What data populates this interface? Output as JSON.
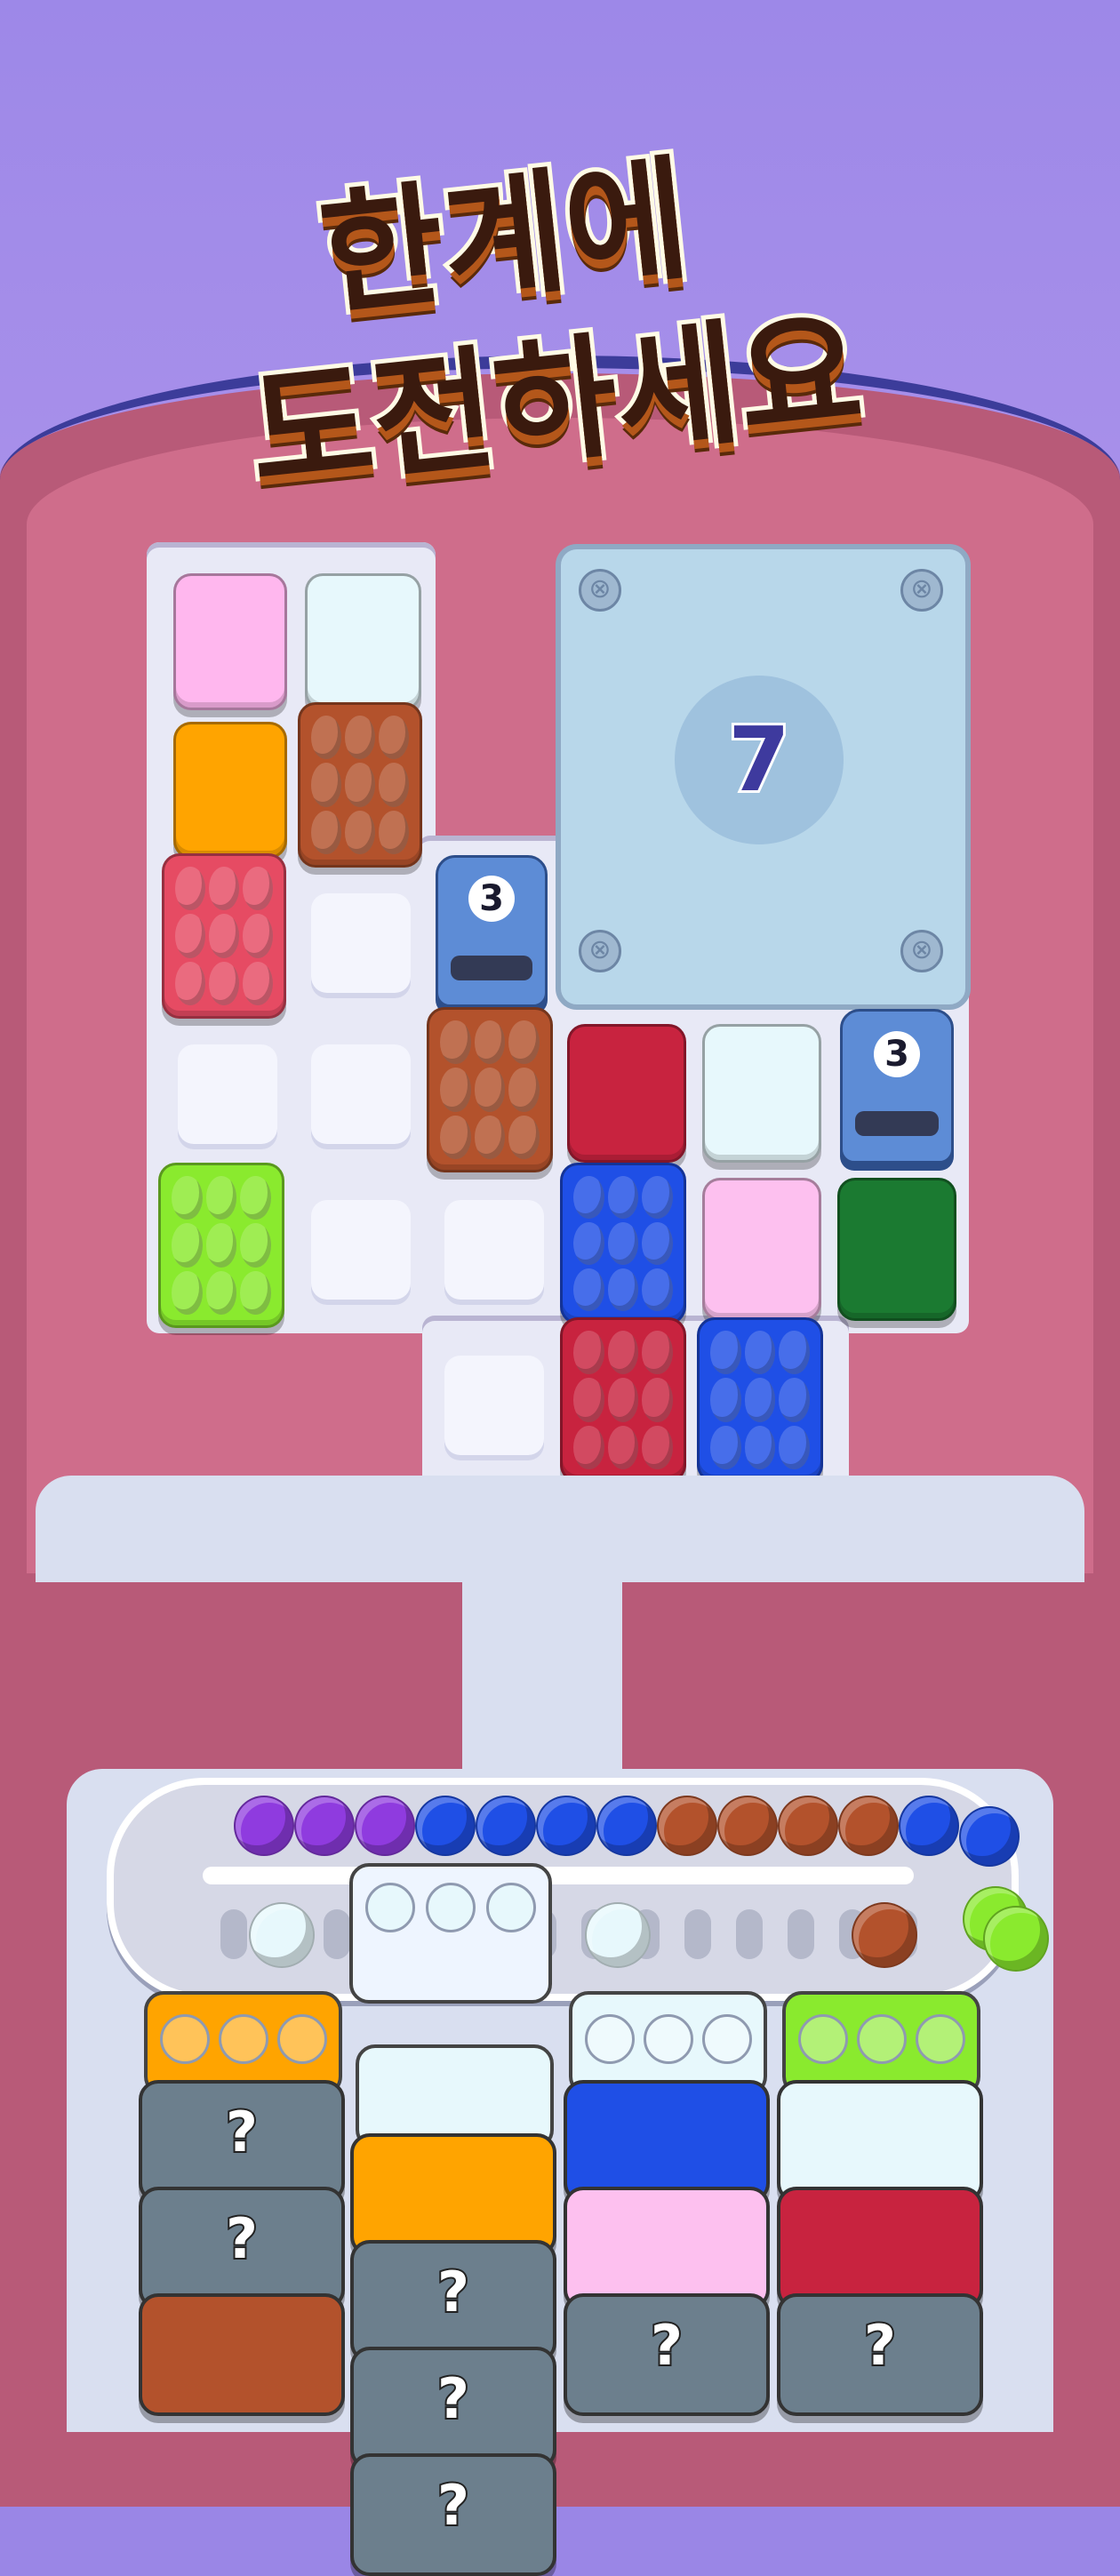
{
  "promo": {
    "title_line1": "한계에",
    "title_line2": "도전하세요"
  },
  "board": {
    "vault": {
      "count": "7",
      "screw_glyph": "⊗"
    },
    "pipes": [
      {
        "count": "3"
      },
      {
        "count": "3"
      }
    ],
    "colors": {
      "pink": "#ffb7ee",
      "ice": "#e7f8fc",
      "orange": "#ffa400",
      "brown": "#b3522c",
      "red": "#e64b63",
      "lime": "#8aea2e",
      "crimson": "#c8233f",
      "blue": "#1f4fe6",
      "green": "#1b7a31",
      "pale_pink": "#fdc0ef",
      "purple": "#8f3bdf"
    }
  },
  "conveyor": {
    "balls_top": [
      "purple",
      "purple",
      "purple",
      "blue",
      "blue",
      "blue",
      "blue",
      "brown",
      "brown",
      "brown",
      "brown",
      "blue",
      "blue"
    ],
    "balls_bottom": [
      "ice",
      "ice",
      "brown",
      "lime",
      "lime"
    ]
  },
  "trays": {
    "columns": [
      {
        "holder_color": "orange",
        "stack": [
          "mystery",
          "mystery",
          "brown"
        ]
      },
      {
        "holder_color": "ice",
        "stack": [
          "orange",
          "mystery",
          "mystery",
          "mystery"
        ]
      },
      {
        "holder_color": "ice",
        "stack": [
          "blue",
          "pale_pink",
          "mystery"
        ]
      },
      {
        "holder_color": "lime",
        "stack": [
          "ice",
          "crimson",
          "mystery"
        ]
      }
    ],
    "mystery_label": "?"
  }
}
